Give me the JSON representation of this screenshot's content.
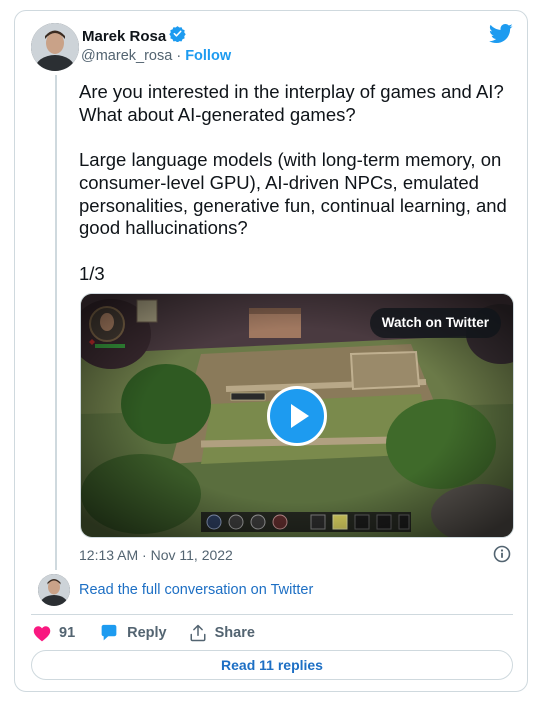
{
  "author": {
    "name": "Marek Rosa",
    "handle": "@marek_rosa",
    "separator": "·",
    "follow_label": "Follow",
    "verified": true
  },
  "tweet": {
    "paragraphs": [
      "Are you interested in the interplay of games and AI? What about AI-generated games?",
      "Large language models (with long-term memory, on consumer-level GPU), AI-driven NPCs, emulated personalities, generative fun, continual learning, and good hallucinations?",
      "1/3"
    ],
    "timestamp": "12:13 AM · Nov 11, 2022"
  },
  "media": {
    "watch_label": "Watch on Twitter"
  },
  "conversation": {
    "read_label": "Read the full conversation on Twitter"
  },
  "actions": {
    "like_count": "91",
    "reply_label": "Reply",
    "share_label": "Share"
  },
  "replies": {
    "label": "Read 11 replies"
  },
  "icons": {
    "logo": "twitter-bird-icon",
    "verified": "verified-badge-icon",
    "like": "heart-icon",
    "reply": "speech-bubble-icon",
    "share": "share-icon",
    "info": "info-icon",
    "play": "play-icon"
  },
  "colors": {
    "brand": "#1d9bf0",
    "like": "#f91880",
    "text": "#0f1419",
    "muted": "#536471",
    "link": "#1d6fc4",
    "border": "#cfd9de"
  }
}
